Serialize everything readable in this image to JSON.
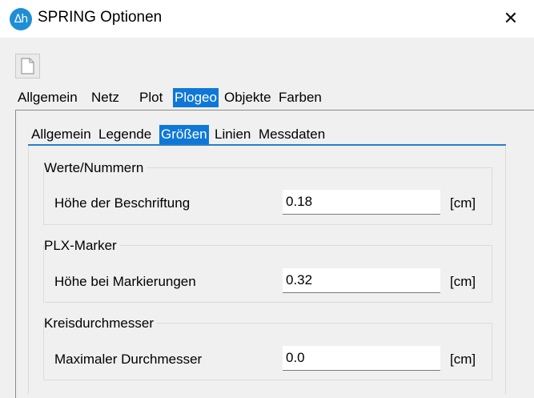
{
  "window": {
    "title": "SPRING Optionen",
    "logo_text": "Δh",
    "close_glyph": "✕"
  },
  "toolbar": {
    "new_document_icon": "document-icon"
  },
  "main_tabs": [
    {
      "label": "Allgemein",
      "active": false
    },
    {
      "label": "Netz",
      "active": false
    },
    {
      "label": "Plot",
      "active": false
    },
    {
      "label": "Plogeo",
      "active": true
    },
    {
      "label": "Objekte",
      "active": false
    },
    {
      "label": "Farben",
      "active": false
    }
  ],
  "sub_tabs": [
    {
      "label": "Allgemein",
      "active": false
    },
    {
      "label": "Legende",
      "active": false
    },
    {
      "label": "Größen",
      "active": true
    },
    {
      "label": "Linien",
      "active": false
    },
    {
      "label": "Messdaten",
      "active": false
    }
  ],
  "groups": [
    {
      "title": "Werte/Nummern",
      "field_label": "Höhe der Beschriftung",
      "value": "0.18",
      "unit": "[cm]"
    },
    {
      "title": "PLX-Marker",
      "field_label": "Höhe bei Markierungen",
      "value": "0.32",
      "unit": "[cm]"
    },
    {
      "title": "Kreisdurchmesser",
      "field_label": "Maximaler Durchmesser",
      "value": "0.0",
      "unit": "[cm]"
    }
  ],
  "colors": {
    "accent": "#0f78d7",
    "logo": "#1f8ed6",
    "window_bg": "#f0f0f0"
  }
}
